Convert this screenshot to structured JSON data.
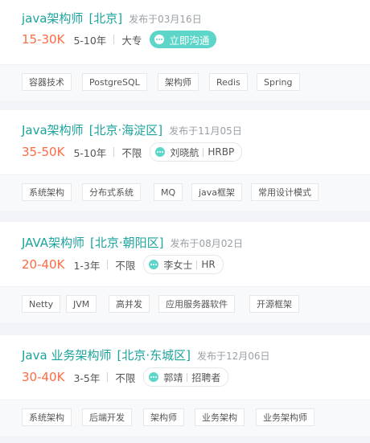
{
  "jobs": [
    {
      "title": "java架构师",
      "location": "[北京]",
      "published": "发布于03月16日",
      "salary": "15-30K",
      "experience": "5-10年",
      "education": "大专",
      "action_label": "立即沟通",
      "tags": [
        "容器技术",
        "PostgreSQL",
        "架构师",
        "Redis",
        "Spring"
      ]
    },
    {
      "title": "Java架构师",
      "location": "[北京·海淀区]",
      "published": "发布于11月05日",
      "salary": "35-50K",
      "experience": "5-10年",
      "education": "不限",
      "recruiter_name": "刘晓航",
      "recruiter_role": "HRBP",
      "tags": [
        "系统架构",
        "分布式系统",
        "MQ",
        "java框架",
        "常用设计模式"
      ]
    },
    {
      "title": "JAVA架构师",
      "location": "[北京·朝阳区]",
      "published": "发布于08月02日",
      "salary": "20-40K",
      "experience": "1-3年",
      "education": "不限",
      "recruiter_name": "李女士",
      "recruiter_role": "HR",
      "tags": [
        "Netty",
        "JVM",
        "高并发",
        "应用服务器软件",
        "开源框架"
      ]
    },
    {
      "title": "Java 业务架构师",
      "location": "[北京·东城区]",
      "published": "发布于12月06日",
      "salary": "30-40K",
      "experience": "3-5年",
      "education": "不限",
      "recruiter_name": "郭靖",
      "recruiter_role": "招聘者",
      "tags": [
        "系统架构",
        "后端开发",
        "架构师",
        "业务架构",
        "业务架构师"
      ]
    }
  ]
}
